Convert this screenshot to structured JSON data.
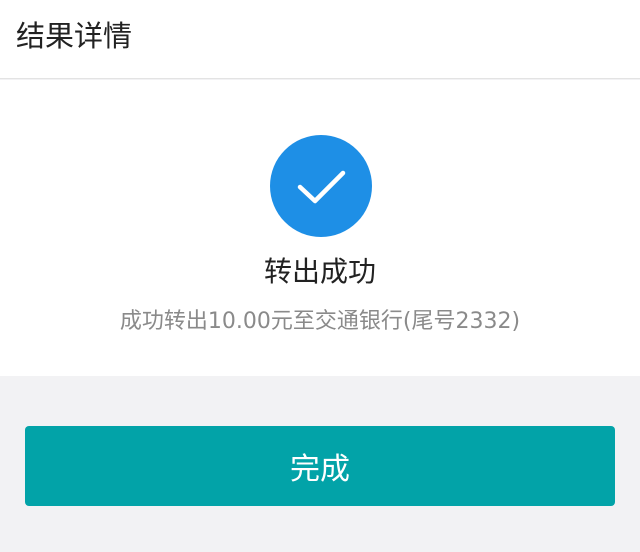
{
  "header": {
    "title": "结果详情"
  },
  "result": {
    "icon": "check-circle-icon",
    "icon_color": "#1e8fe6",
    "title": "转出成功",
    "detail": "成功转出10.00元至交通银行(尾号2332)"
  },
  "actions": {
    "done_label": "完成",
    "done_color": "#02a3a8"
  }
}
